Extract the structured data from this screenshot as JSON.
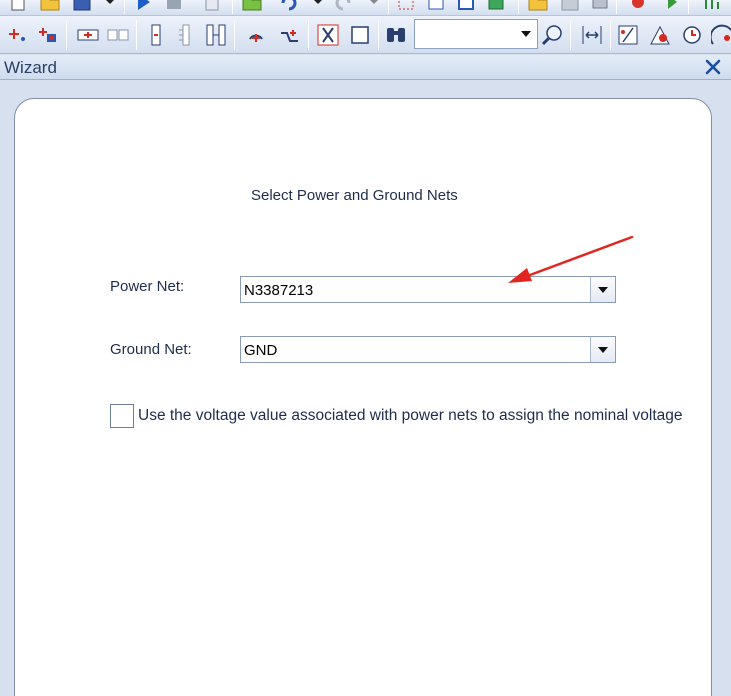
{
  "panel": {
    "title": "Wizard"
  },
  "wizard": {
    "heading": "Select Power and Ground Nets",
    "power_net": {
      "label": "Power Net:",
      "value": "N3387213"
    },
    "ground_net": {
      "label": "Ground Net:",
      "value": "GND"
    },
    "nominal_voltage_checkbox": {
      "label": "Use the voltage value associated with power nets to assign the nominal voltage",
      "checked": false
    }
  },
  "toolbar": {
    "search_value": ""
  },
  "colors": {
    "accent": "#1a4fa0",
    "annotation_arrow": "#e2261f",
    "panel_bg": "#d6e0ef"
  }
}
